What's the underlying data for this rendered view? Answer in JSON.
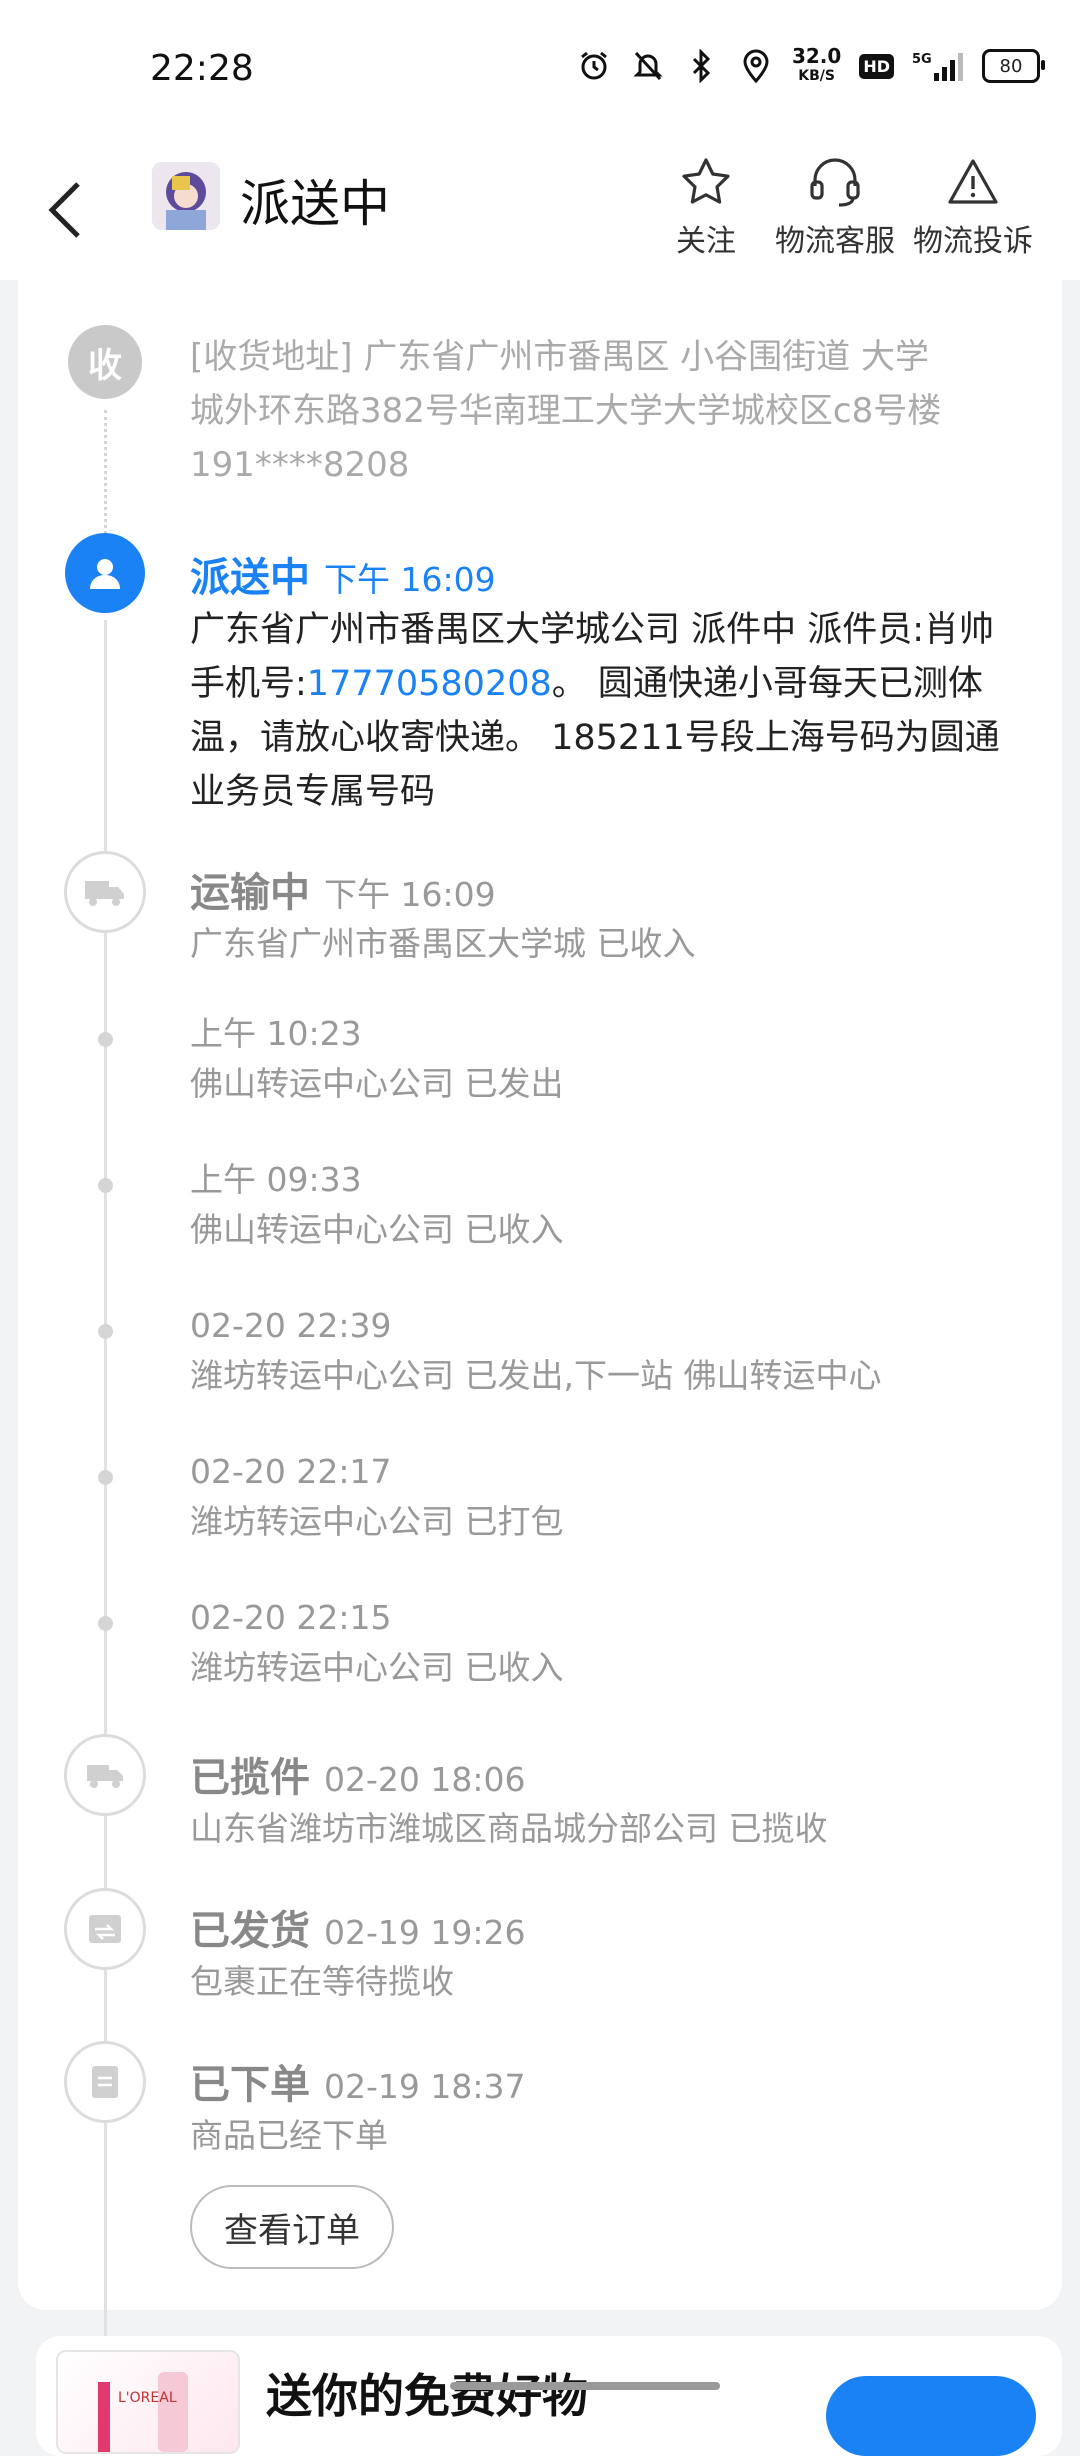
{
  "status_bar": {
    "time": "22:28",
    "net_speed_value": "32.0",
    "net_speed_unit": "KB/S",
    "hd_label": "HD",
    "signal_label": "5G",
    "battery": "80"
  },
  "header": {
    "title": "派送中",
    "actions": [
      {
        "label": "关注",
        "icon": "star-icon"
      },
      {
        "label": "物流客服",
        "icon": "headset-icon"
      },
      {
        "label": "物流投诉",
        "icon": "warning-icon"
      }
    ]
  },
  "delivery": {
    "address_node_label": "收",
    "address_line1": "[收货地址] 广东省广州市番禺区 小谷围街道   大学",
    "address_line2": "城外环东路382号华南理工大学大学城校区c8号楼",
    "address_line3": "191****8208",
    "events": [
      {
        "title": "派送中",
        "time": "下午 16:09",
        "desc_before": "广东省广州市番禺区大学城公司 派件中 派件员:肖帅 手机号:",
        "phone": "17770580208",
        "desc_after": "。 圆通快递小哥每天已测体温，请放心收寄快递。 185211号段上海号码为圆通业务员专属号码"
      },
      {
        "title": "运输中",
        "time": "下午 16:09",
        "desc": "广东省广州市番禺区大学城 已收入"
      },
      {
        "time": "上午 10:23",
        "desc": "佛山转运中心公司 已发出"
      },
      {
        "time": "上午 09:33",
        "desc": "佛山转运中心公司 已收入"
      },
      {
        "time": "02-20 22:39",
        "desc": "潍坊转运中心公司 已发出,下一站 佛山转运中心"
      },
      {
        "time": "02-20 22:17",
        "desc": "潍坊转运中心公司 已打包"
      },
      {
        "time": "02-20 22:15",
        "desc": "潍坊转运中心公司 已收入"
      },
      {
        "title": "已揽件",
        "time": "02-20 18:06",
        "desc": "山东省潍坊市潍城区商品城分部公司 已揽收"
      },
      {
        "title": "已发货",
        "time": "02-19 19:26",
        "desc": "包裹正在等待揽收"
      },
      {
        "title": "已下单",
        "time": "02-19 18:37",
        "desc": "商品已经下单"
      }
    ],
    "view_order_label": "查看订单"
  },
  "promo": {
    "title": "送你的免费好物",
    "image_brand": "L'OREAL"
  },
  "colors": {
    "accent": "#1a82f5",
    "muted_text": "#999999",
    "node_grey": "#c9c9c9"
  }
}
